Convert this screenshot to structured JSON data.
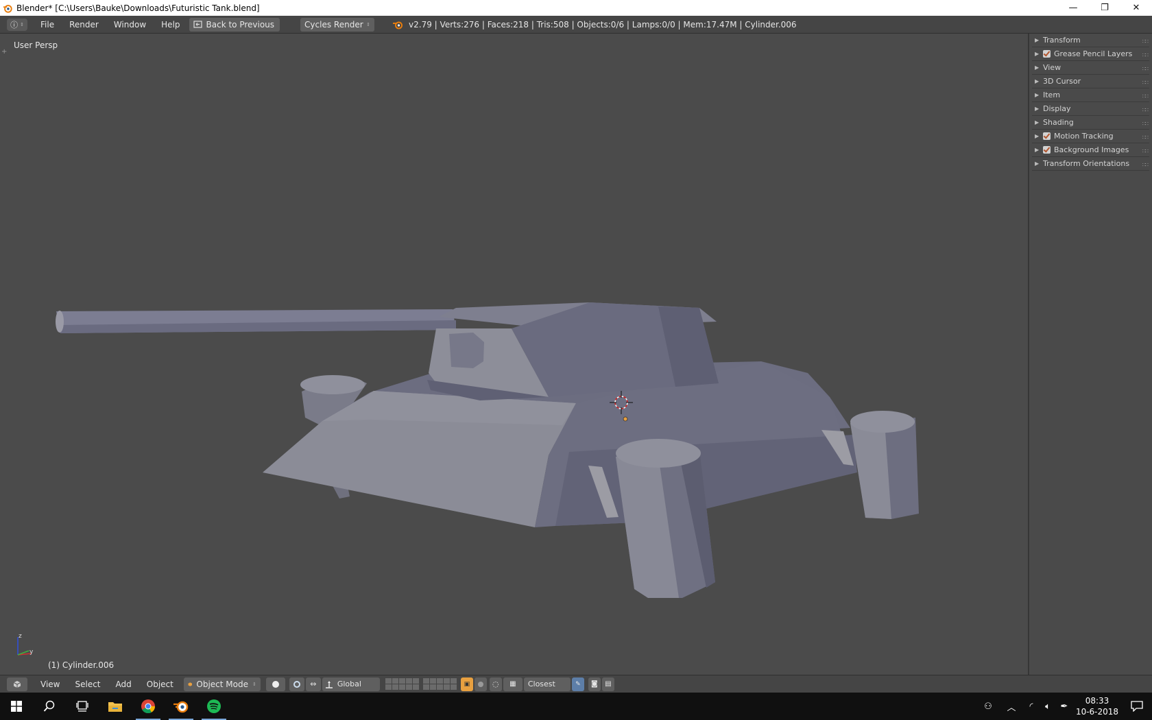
{
  "window": {
    "title": "Blender* [C:\\Users\\Bauke\\Downloads\\Futuristic Tank.blend]",
    "minimize_glyph": "—",
    "maximize_glyph": "❐",
    "close_glyph": "✕"
  },
  "infobar": {
    "editor_glyph": "ⓘ",
    "menus": [
      "File",
      "Render",
      "Window",
      "Help"
    ],
    "back_label": "Back to Previous",
    "render_engine": "Cycles Render",
    "stats": "v2.79 | Verts:276 | Faces:218 | Tris:508 | Objects:0/6 | Lamps:0/0 | Mem:17.47M | Cylinder.006"
  },
  "viewport": {
    "view_label": "User Persp",
    "object_label": "(1) Cylinder.006",
    "axis_z": "z",
    "axis_y": "y"
  },
  "properties": {
    "panels": [
      {
        "label": "Transform",
        "checkbox": false
      },
      {
        "label": "Grease Pencil Layers",
        "checkbox": true
      },
      {
        "label": "View",
        "checkbox": false
      },
      {
        "label": "3D Cursor",
        "checkbox": false
      },
      {
        "label": "Item",
        "checkbox": false
      },
      {
        "label": "Display",
        "checkbox": false
      },
      {
        "label": "Shading",
        "checkbox": false
      },
      {
        "label": "Motion Tracking",
        "checkbox": true
      },
      {
        "label": "Background Images",
        "checkbox": true
      },
      {
        "label": "Transform Orientations",
        "checkbox": false
      }
    ]
  },
  "header": {
    "menus": [
      "View",
      "Select",
      "Add",
      "Object"
    ],
    "mode": "Object Mode",
    "orientation": "Global",
    "snap_target": "Closest"
  },
  "taskbar": {
    "time": "08:33",
    "date": "10-6-2018"
  },
  "colors": {
    "viewport_bg": "#4b4b4b",
    "panel_bg": "#454545",
    "accent_orange": "#e87d0d",
    "mesh_light": "#8a8a96",
    "mesh_dark": "#656577"
  }
}
